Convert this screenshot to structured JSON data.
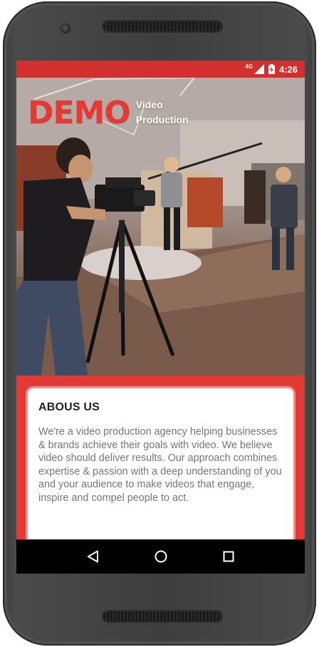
{
  "status_bar": {
    "network": "4G",
    "time": "4:26",
    "icons": [
      "signal-icon",
      "battery-charging-icon"
    ]
  },
  "hero": {
    "logo_word": "DEMO",
    "logo_sub_line1": "Video",
    "logo_sub_line2": "Production"
  },
  "about": {
    "title": "ABOUS US",
    "body": "We're a video production agency helping businesses & brands achieve their goals with video. We believe video should deliver results. Our approach combines expertise & passion with a deep understanding of you and your audience to make videos that engage, inspire and compel people to act."
  },
  "nav_bar": {
    "icons": [
      "back-icon",
      "home-icon",
      "recents-icon"
    ]
  },
  "colors": {
    "accent": "#e53935",
    "status_bar": "#d32f2f",
    "nav_bar": "#000000",
    "card": "#ffffff",
    "body_text": "#757575"
  }
}
